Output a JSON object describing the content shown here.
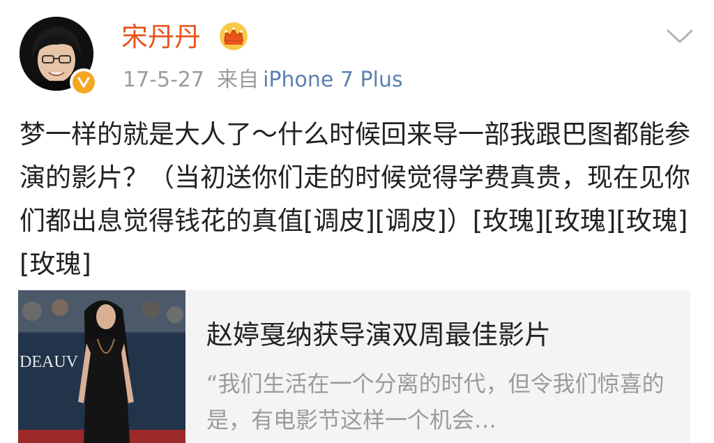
{
  "post": {
    "author": {
      "name": "宋丹丹",
      "verified": true,
      "crown_icon": "crown-icon",
      "verified_icon": "verified-v-icon"
    },
    "meta": {
      "date": "17-5-27",
      "source_prefix": "来自",
      "device": "iPhone 7 Plus"
    },
    "menu_icon": "chevron-down-icon",
    "text": "梦一样的就是大人了～什么时候回来导一部我跟巴图都能参演的影片？（当初送你们走的时候觉得学费真贵，现在见你们都出息觉得钱花的真值[调皮][调皮]）[玫瑰][玫瑰][玫瑰][玫瑰]"
  },
  "link_card": {
    "title": "赵婷戛纳获导演双周最佳影片",
    "description": "“我们生活在一个分离的时代，但令我们惊喜的是，有电影节这样一个机会…",
    "thumbnail_backdrop_text": "DEAUV"
  },
  "colors": {
    "username": "#e8541c",
    "meta_gray": "#9b9b9b",
    "device_link": "#5b7fb0",
    "badge": "#f5a623",
    "card_bg": "#f4f4f4"
  }
}
